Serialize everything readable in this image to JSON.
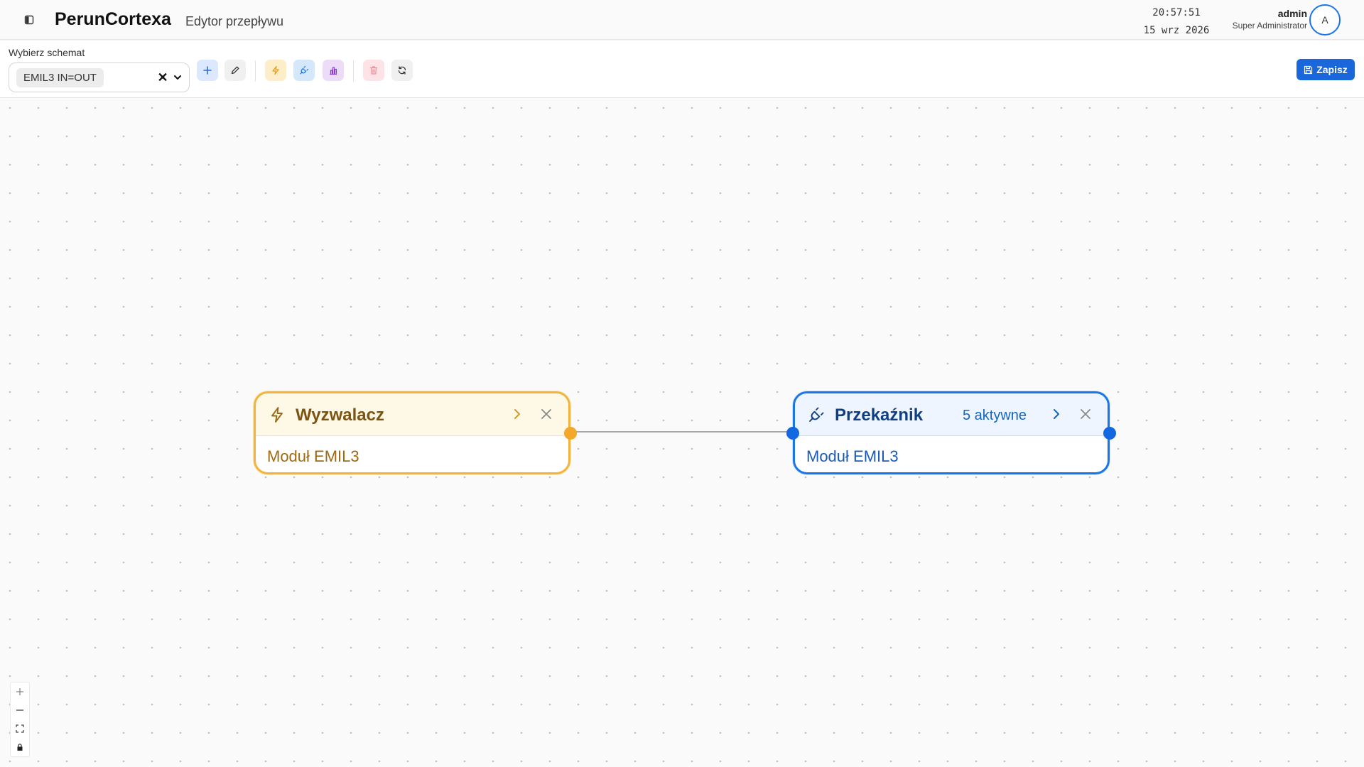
{
  "header": {
    "brand": "PerunCortexa",
    "subtitle": "Edytor przepływu",
    "time": "20:57:51",
    "date": "15 wrz 2026",
    "user_name": "admin",
    "user_role": "Super Administrator",
    "avatar_initial": "A"
  },
  "toolbar": {
    "schema_label": "Wybierz schemat",
    "schema_selected": "EMIL3 IN=OUT",
    "clear_symbol": "✕",
    "save_label": "Zapisz",
    "buttons": [
      {
        "name": "add",
        "icon": "plus-icon"
      },
      {
        "name": "edit",
        "icon": "pencil-icon"
      },
      {
        "name": "add-trigger",
        "icon": "lightning-icon"
      },
      {
        "name": "add-relay",
        "icon": "plug-icon"
      },
      {
        "name": "add-chart",
        "icon": "bar-chart-icon"
      },
      {
        "name": "delete",
        "icon": "trash-icon"
      },
      {
        "name": "refresh",
        "icon": "refresh-icon"
      }
    ]
  },
  "nodes": {
    "trigger": {
      "title": "Wyzwalacz",
      "body": "Moduł EMIL3",
      "icon": "lightning-icon",
      "color": "#f3b43f"
    },
    "relay": {
      "title": "Przekaźnik",
      "badge": "5 aktywne",
      "body": "Moduł EMIL3",
      "icon": "plug-icon",
      "color": "#1976e6"
    }
  },
  "colors": {
    "accent": "#1a66db",
    "trigger": "#f3b43f",
    "relay": "#1976e6"
  }
}
